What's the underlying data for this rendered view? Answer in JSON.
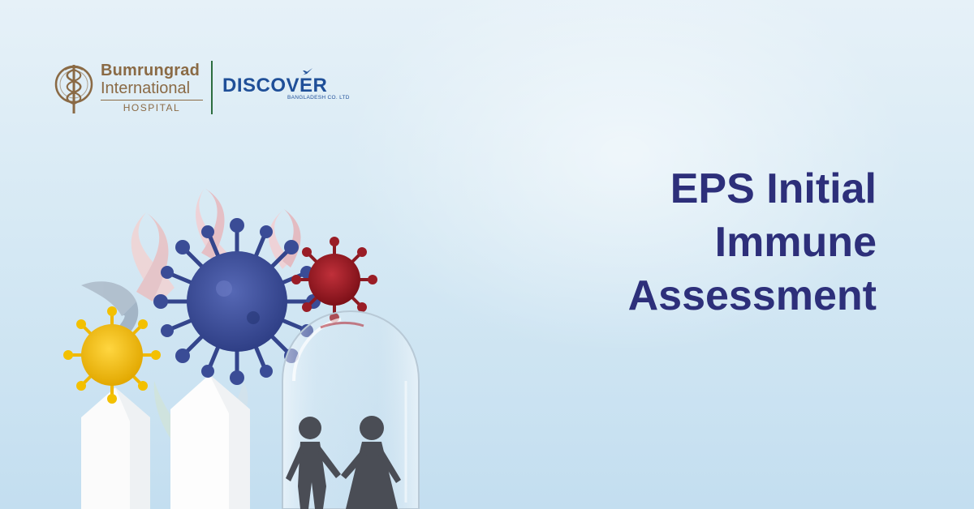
{
  "logos": {
    "bumrungrad": {
      "name": "Bumrungrad",
      "subtitle": "International",
      "tagline": "HOSPITAL"
    },
    "discover": {
      "name": "DISCOVER",
      "tagline": "BANGLADESH CO. LTD"
    }
  },
  "headline": {
    "line1": "EPS Initial",
    "line2": "Immune",
    "line3": "Assessment"
  },
  "colors": {
    "headline": "#2d2f7a",
    "bumrungrad_brand": "#8a6a45",
    "discover_brand": "#1f4f98",
    "divider": "#2c6d3f"
  },
  "icons": [
    "caduceus-emblem-icon",
    "airplane-icon"
  ]
}
